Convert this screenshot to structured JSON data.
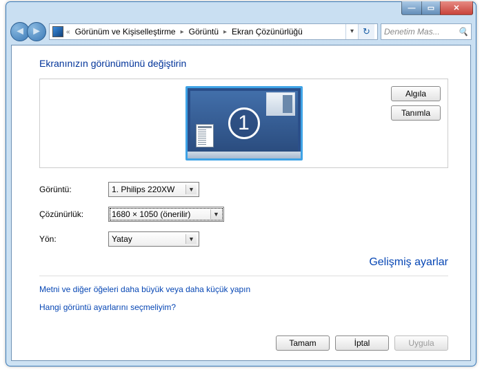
{
  "window": {
    "min_icon": "―",
    "max_icon": "▭",
    "close_icon": "✕"
  },
  "nav": {
    "back_icon": "◄",
    "fwd_icon": "►"
  },
  "breadcrumb": {
    "prefix": "«",
    "seg1": "Görünüm ve Kişiselleştirme",
    "seg2": "Görüntü",
    "seg3": "Ekran Çözünürlüğü",
    "arrow": "▸",
    "drop": "▾",
    "refresh": "↻"
  },
  "search": {
    "placeholder": "Denetim Mas...",
    "icon": "🔍"
  },
  "heading": "Ekranınızın görünümünü değiştirin",
  "monitor_number": "1",
  "buttons": {
    "detect": "Algıla",
    "identify": "Tanımla",
    "ok": "Tamam",
    "cancel": "İptal",
    "apply": "Uygula"
  },
  "labels": {
    "display": "Görüntü:",
    "resolution": "Çözünürlük:",
    "orientation": "Yön:"
  },
  "values": {
    "display": "1. Philips 220XW",
    "resolution": "1680 × 1050 (önerilir)",
    "orientation": "Yatay"
  },
  "links": {
    "advanced": "Gelişmiş ayarlar",
    "textsize": "Metni ve diğer öğeleri daha büyük veya daha küçük yapın",
    "which": "Hangi görüntü ayarlarını seçmeliyim?"
  }
}
